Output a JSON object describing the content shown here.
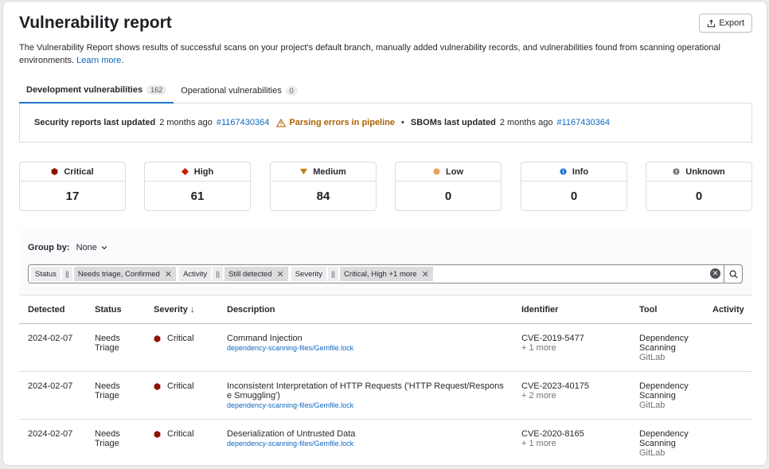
{
  "header": {
    "title": "Vulnerability report",
    "export_label": "Export",
    "intro_text": "The Vulnerability Report shows results of successful scans on your project's default branch, manually added vulnerability records, and vulnerabilities found from scanning operational environments.",
    "learn_more": "Learn more",
    "intro_period": "."
  },
  "tabs": [
    {
      "label": "Development vulnerabilities",
      "count": "162",
      "active": true
    },
    {
      "label": "Operational vulnerabilities",
      "count": "0",
      "active": false
    }
  ],
  "status": {
    "security_label": "Security reports last updated",
    "security_time": "2 months ago",
    "security_pipeline": "#1167430364",
    "parsing_errors": "Parsing errors in pipeline",
    "sep": "•",
    "sbom_label": "SBOMs last updated",
    "sbom_time": "2 months ago",
    "sbom_pipeline": "#1167430364"
  },
  "severity_cards": [
    {
      "label": "Critical",
      "count": "17",
      "icon": "critical-icon",
      "color": "#8d1300"
    },
    {
      "label": "High",
      "count": "61",
      "icon": "high-icon",
      "color": "#c91c00"
    },
    {
      "label": "Medium",
      "count": "84",
      "icon": "medium-icon",
      "color": "#c17d10"
    },
    {
      "label": "Low",
      "count": "0",
      "icon": "low-icon",
      "color": "#e9a15b"
    },
    {
      "label": "Info",
      "count": "0",
      "icon": "info-icon",
      "color": "#1f75cb"
    },
    {
      "label": "Unknown",
      "count": "0",
      "icon": "unknown-icon",
      "color": "#737278"
    }
  ],
  "group_by": {
    "label": "Group by:",
    "value": "None"
  },
  "filters": [
    {
      "key": "Status",
      "op": "||",
      "value": "Needs triage, Confirmed"
    },
    {
      "key": "Activity",
      "op": "||",
      "value": "Still detected"
    },
    {
      "key": "Severity",
      "op": "||",
      "value": "Critical, High +1 more"
    }
  ],
  "table": {
    "headers": {
      "detected": "Detected",
      "status": "Status",
      "severity": "Severity ↓",
      "description": "Description",
      "identifier": "Identifier",
      "tool": "Tool",
      "activity": "Activity"
    },
    "rows": [
      {
        "detected": "2024-02-07",
        "status_1": "Needs",
        "status_2": "Triage",
        "severity": "Critical",
        "desc_1": "Command Injection",
        "desc_2": "",
        "file": "dependency-scanning-files/Gemfile.lock",
        "identifier": "CVE-2019-5477",
        "more": "+ 1 more",
        "tool_1": "Dependency",
        "tool_2": "Scanning",
        "vendor": "GitLab"
      },
      {
        "detected": "2024-02-07",
        "status_1": "Needs",
        "status_2": "Triage",
        "severity": "Critical",
        "desc_1": "Inconsistent Interpretation of HTTP Requests ('HTTP Request/Respons",
        "desc_2": "e Smuggling')",
        "file": "dependency-scanning-files/Gemfile.lock",
        "identifier": "CVE-2023-40175",
        "more": "+ 2 more",
        "tool_1": "Dependency",
        "tool_2": "Scanning",
        "vendor": "GitLab"
      },
      {
        "detected": "2024-02-07",
        "status_1": "Needs",
        "status_2": "Triage",
        "severity": "Critical",
        "desc_1": "Deserialization of Untrusted Data",
        "desc_2": "",
        "file": "dependency-scanning-files/Gemfile.lock",
        "identifier": "CVE-2020-8165",
        "more": "+ 1 more",
        "tool_1": "Dependency",
        "tool_2": "Scanning",
        "vendor": "GitLab"
      }
    ]
  }
}
